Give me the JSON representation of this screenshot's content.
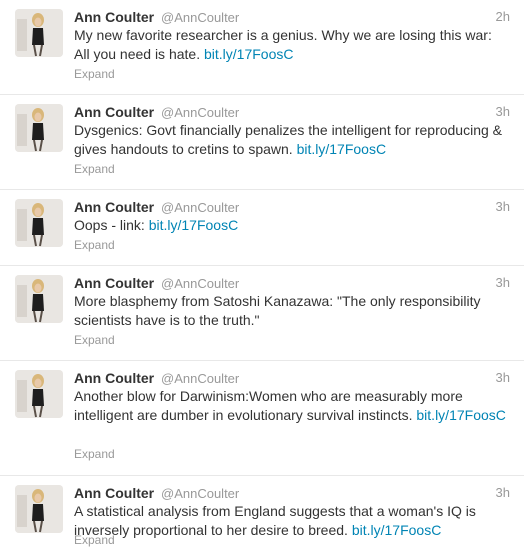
{
  "tweets": [
    {
      "name": "Ann Coulter",
      "handle": "@AnnCoulter",
      "time": "2h",
      "text": "My new favorite researcher is a genius. Why we are losing this war: All you need is hate.",
      "link": "bit.ly/17FoosC",
      "expand": "Expand"
    },
    {
      "name": "Ann Coulter",
      "handle": "@AnnCoulter",
      "time": "3h",
      "text": "Dysgenics: Govt financially penalizes the intelligent for reproducing & gives handouts to cretins to spawn.",
      "link": "bit.ly/17FoosC",
      "expand": "Expand"
    },
    {
      "name": "Ann Coulter",
      "handle": "@AnnCoulter",
      "time": "3h",
      "text": "Oops - link:",
      "link": "bit.ly/17FoosC",
      "expand": "Expand"
    },
    {
      "name": "Ann Coulter",
      "handle": "@AnnCoulter",
      "time": "3h",
      "text": "More blasphemy from Satoshi Kanazawa: \"The only responsibility scientists have is to the truth.\"",
      "link": "",
      "expand": "Expand"
    },
    {
      "name": "Ann Coulter",
      "handle": "@AnnCoulter",
      "time": "3h",
      "text": "Another blow for Darwinism:Women who are measurably more intelligent are dumber in evolutionary survival instincts.",
      "link": "bit.ly/17FoosC",
      "expand": "Expand"
    },
    {
      "name": "Ann Coulter",
      "handle": "@AnnCoulter",
      "time": "3h",
      "text": "A statistical analysis from England suggests that a woman's IQ is inversely proportional to her desire to breed.",
      "link": "bit.ly/17FoosC",
      "expand": "Expand"
    }
  ]
}
